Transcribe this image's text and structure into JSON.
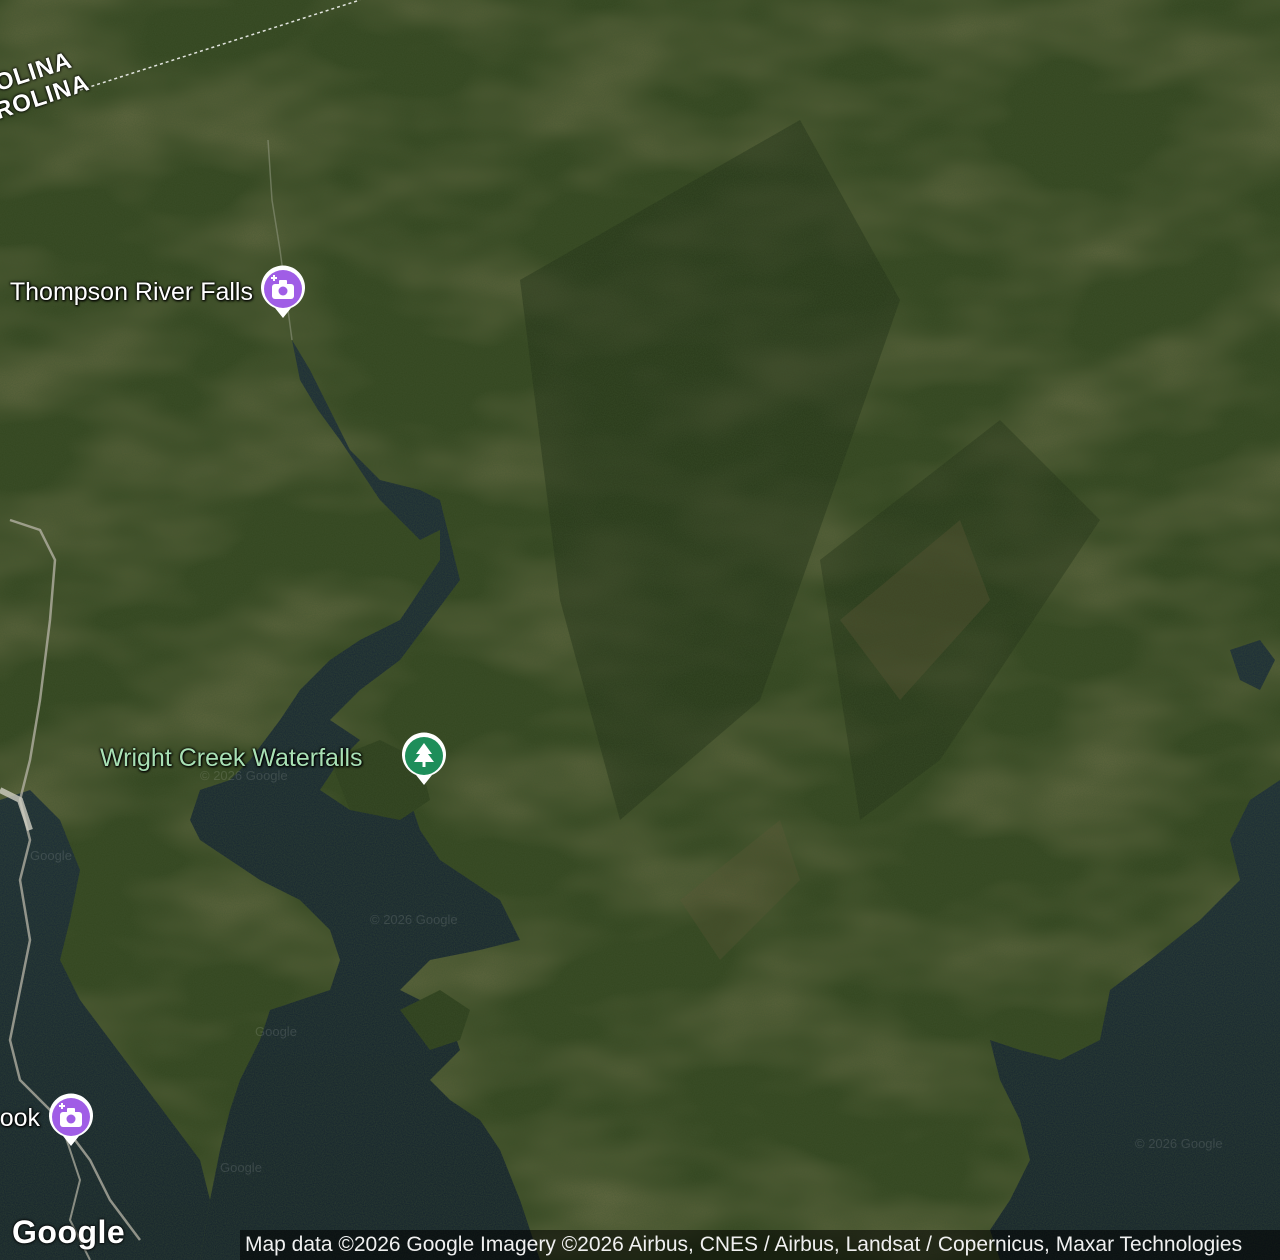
{
  "map": {
    "type": "satellite",
    "places": [
      {
        "name": "Thompson River Falls",
        "icon": "camera-icon",
        "color": "#a05de6"
      },
      {
        "name": "Wright Creek Waterfalls",
        "icon": "tree-icon",
        "color": "#1e8e5a"
      },
      {
        "name": "ook",
        "icon": "camera-icon",
        "color": "#a05de6"
      }
    ],
    "state_labels": [
      "OLINA",
      "ROLINA"
    ],
    "watermarks": [
      "© 2026 Google",
      "© 2026 Google",
      "© 2026 Google",
      "Google",
      "Google",
      "Google"
    ]
  },
  "footer": {
    "logo": "Google",
    "attribution": "Map data ©2026 Google Imagery ©2026 Airbus, CNES / Airbus, Landsat / Copernicus, Maxar Technologies"
  }
}
